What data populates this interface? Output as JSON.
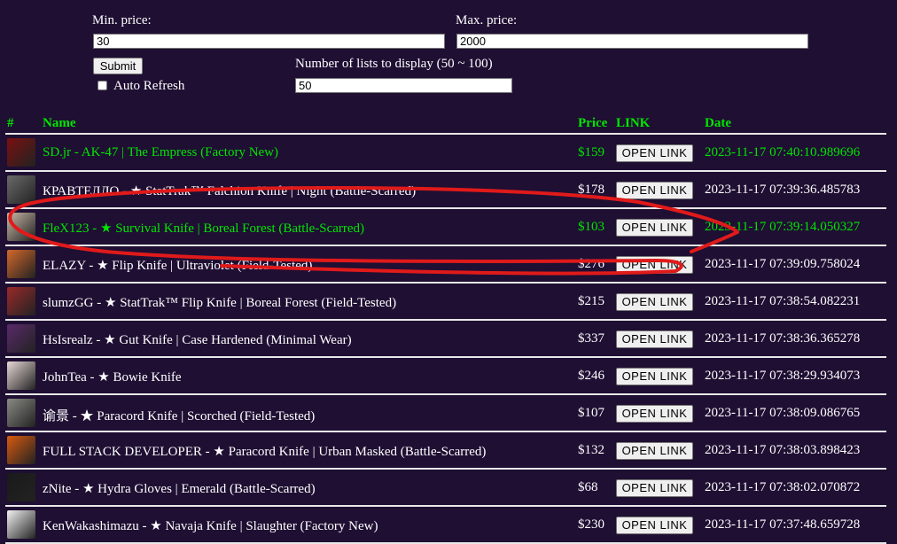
{
  "filters": {
    "min_label": "Min. price:",
    "min_value": "30",
    "max_label": "Max. price:",
    "max_value": "2000",
    "submit_label": "Submit",
    "auto_refresh_label": "Auto Refresh",
    "auto_refresh_checked": false,
    "lists_label": "Number of lists to display (50 ~ 100)",
    "lists_value": "50"
  },
  "table": {
    "headers": [
      "#",
      "Name",
      "Price",
      "LINK",
      "Date"
    ],
    "link_label": "OPEN LINK",
    "rows": [
      {
        "name": "SD.jr - AK-47 | The Empress (Factory New)",
        "price": "$159",
        "date": "2023-11-17 07:40:10.989696",
        "highlight": true,
        "thumb": "#7a1010"
      },
      {
        "name": "КРАВТЕЛЛО - ★ StatTrak™ Falchion Knife | Night (Battle-Scarred)",
        "price": "$178",
        "date": "2023-11-17 07:39:36.485783",
        "highlight": false,
        "thumb": "#6a6a6a"
      },
      {
        "name": "FleX123 - ★ Survival Knife | Boreal Forest (Battle-Scarred)",
        "price": "$103",
        "date": "2023-11-17 07:39:14.050327",
        "highlight": true,
        "thumb": "#c9b8a6"
      },
      {
        "name": "ELAZY - ★ Flip Knife | Ultraviolet (Field-Tested)",
        "price": "$276",
        "date": "2023-11-17 07:39:09.758024",
        "highlight": false,
        "thumb": "#d2682a"
      },
      {
        "name": "slumzGG - ★ StatTrak™ Flip Knife | Boreal Forest (Field-Tested)",
        "price": "$215",
        "date": "2023-11-17 07:38:54.082231",
        "highlight": false,
        "thumb": "#9a2a2a"
      },
      {
        "name": "HsIsrealz - ★ Gut Knife | Case Hardened (Minimal Wear)",
        "price": "$337",
        "date": "2023-11-17 07:38:36.365278",
        "highlight": false,
        "thumb": "#5a2a6a"
      },
      {
        "name": "JohnTea - ★ Bowie Knife",
        "price": "$246",
        "date": "2023-11-17 07:38:29.934073",
        "highlight": false,
        "thumb": "#e6d8d6"
      },
      {
        "name": "谕景 - ★ Paracord Knife | Scorched (Field-Tested)",
        "price": "$107",
        "date": "2023-11-17 07:38:09.086765",
        "highlight": false,
        "thumb": "#8a8a84"
      },
      {
        "name": "FULL STACK DEVELOPER - ★ Paracord Knife | Urban Masked (Battle-Scarred)",
        "price": "$132",
        "date": "2023-11-17 07:38:03.898423",
        "highlight": false,
        "thumb": "#d85a10"
      },
      {
        "name": "zNite - ★ Hydra Gloves | Emerald (Battle-Scarred)",
        "price": "$68",
        "date": "2023-11-17 07:38:02.070872",
        "highlight": false,
        "thumb": "#1a1a1a"
      },
      {
        "name": "KenWakashimazu - ★ Navaja Knife | Slaughter (Factory New)",
        "price": "$230",
        "date": "2023-11-17 07:37:48.659728",
        "highlight": false,
        "thumb": "#f2f2f2"
      }
    ]
  },
  "colors": {
    "background": "#1f0f33",
    "header_green": "#00e600",
    "highlight_green": "#00e600",
    "annotation_red": "#e01a1a"
  }
}
